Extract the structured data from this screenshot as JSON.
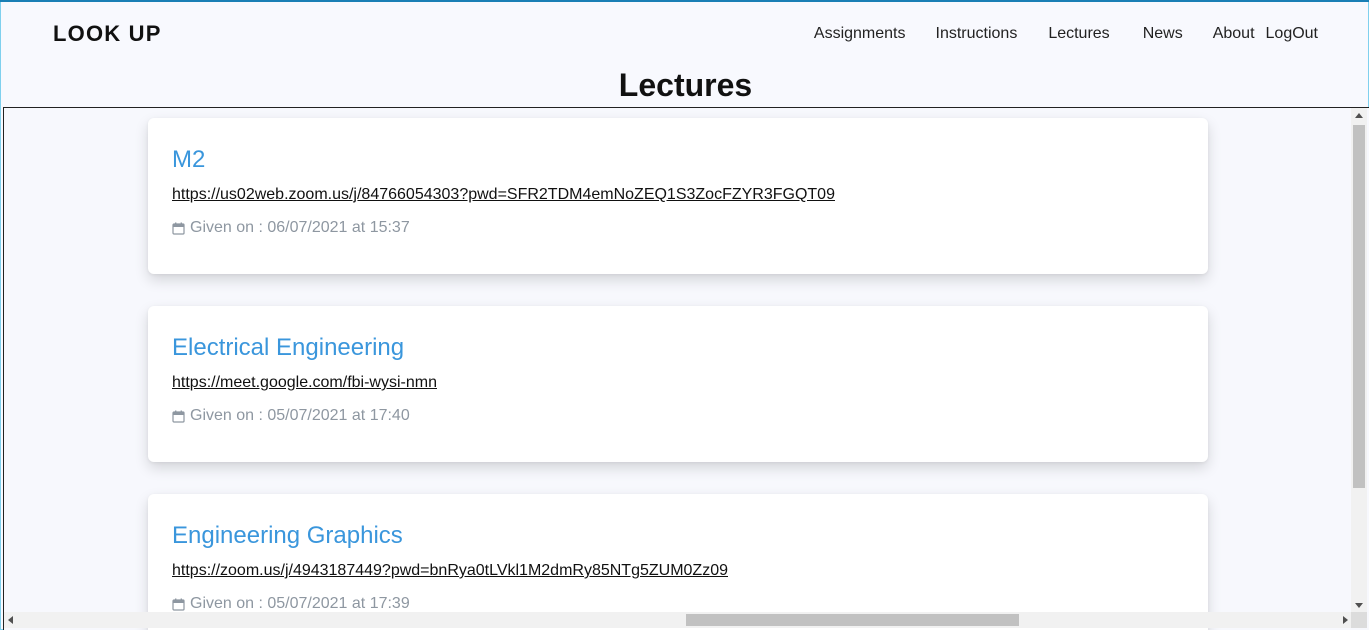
{
  "header": {
    "brand": "LOOK UP",
    "nav": [
      "Assignments",
      "Instructions",
      "Lectures",
      "News",
      "About",
      "LogOut"
    ]
  },
  "page_title": "Lectures",
  "lectures": [
    {
      "title": "M2",
      "link": "https://us02web.zoom.us/j/84766054303?pwd=SFR2TDM4emNoZEQ1S3ZocFZYR3FGQT09",
      "given": "Given on : 06/07/2021 at 15:37"
    },
    {
      "title": "Electrical Engineering",
      "link": "https://meet.google.com/fbi-wysi-nmn",
      "given": "Given on : 05/07/2021 at 17:40"
    },
    {
      "title": "Engineering Graphics",
      "link": "https://zoom.us/j/4943187449?pwd=bnRya0tLVkl1M2dmRy85NTg5ZUM0Zz09",
      "given": "Given on : 05/07/2021 at 17:39"
    }
  ],
  "icons": {
    "date": "calendar-icon"
  },
  "colors": {
    "title": "#3a96dc",
    "meta": "#8e97a1",
    "background": "#f8f9fe",
    "card": "#ffffff"
  }
}
